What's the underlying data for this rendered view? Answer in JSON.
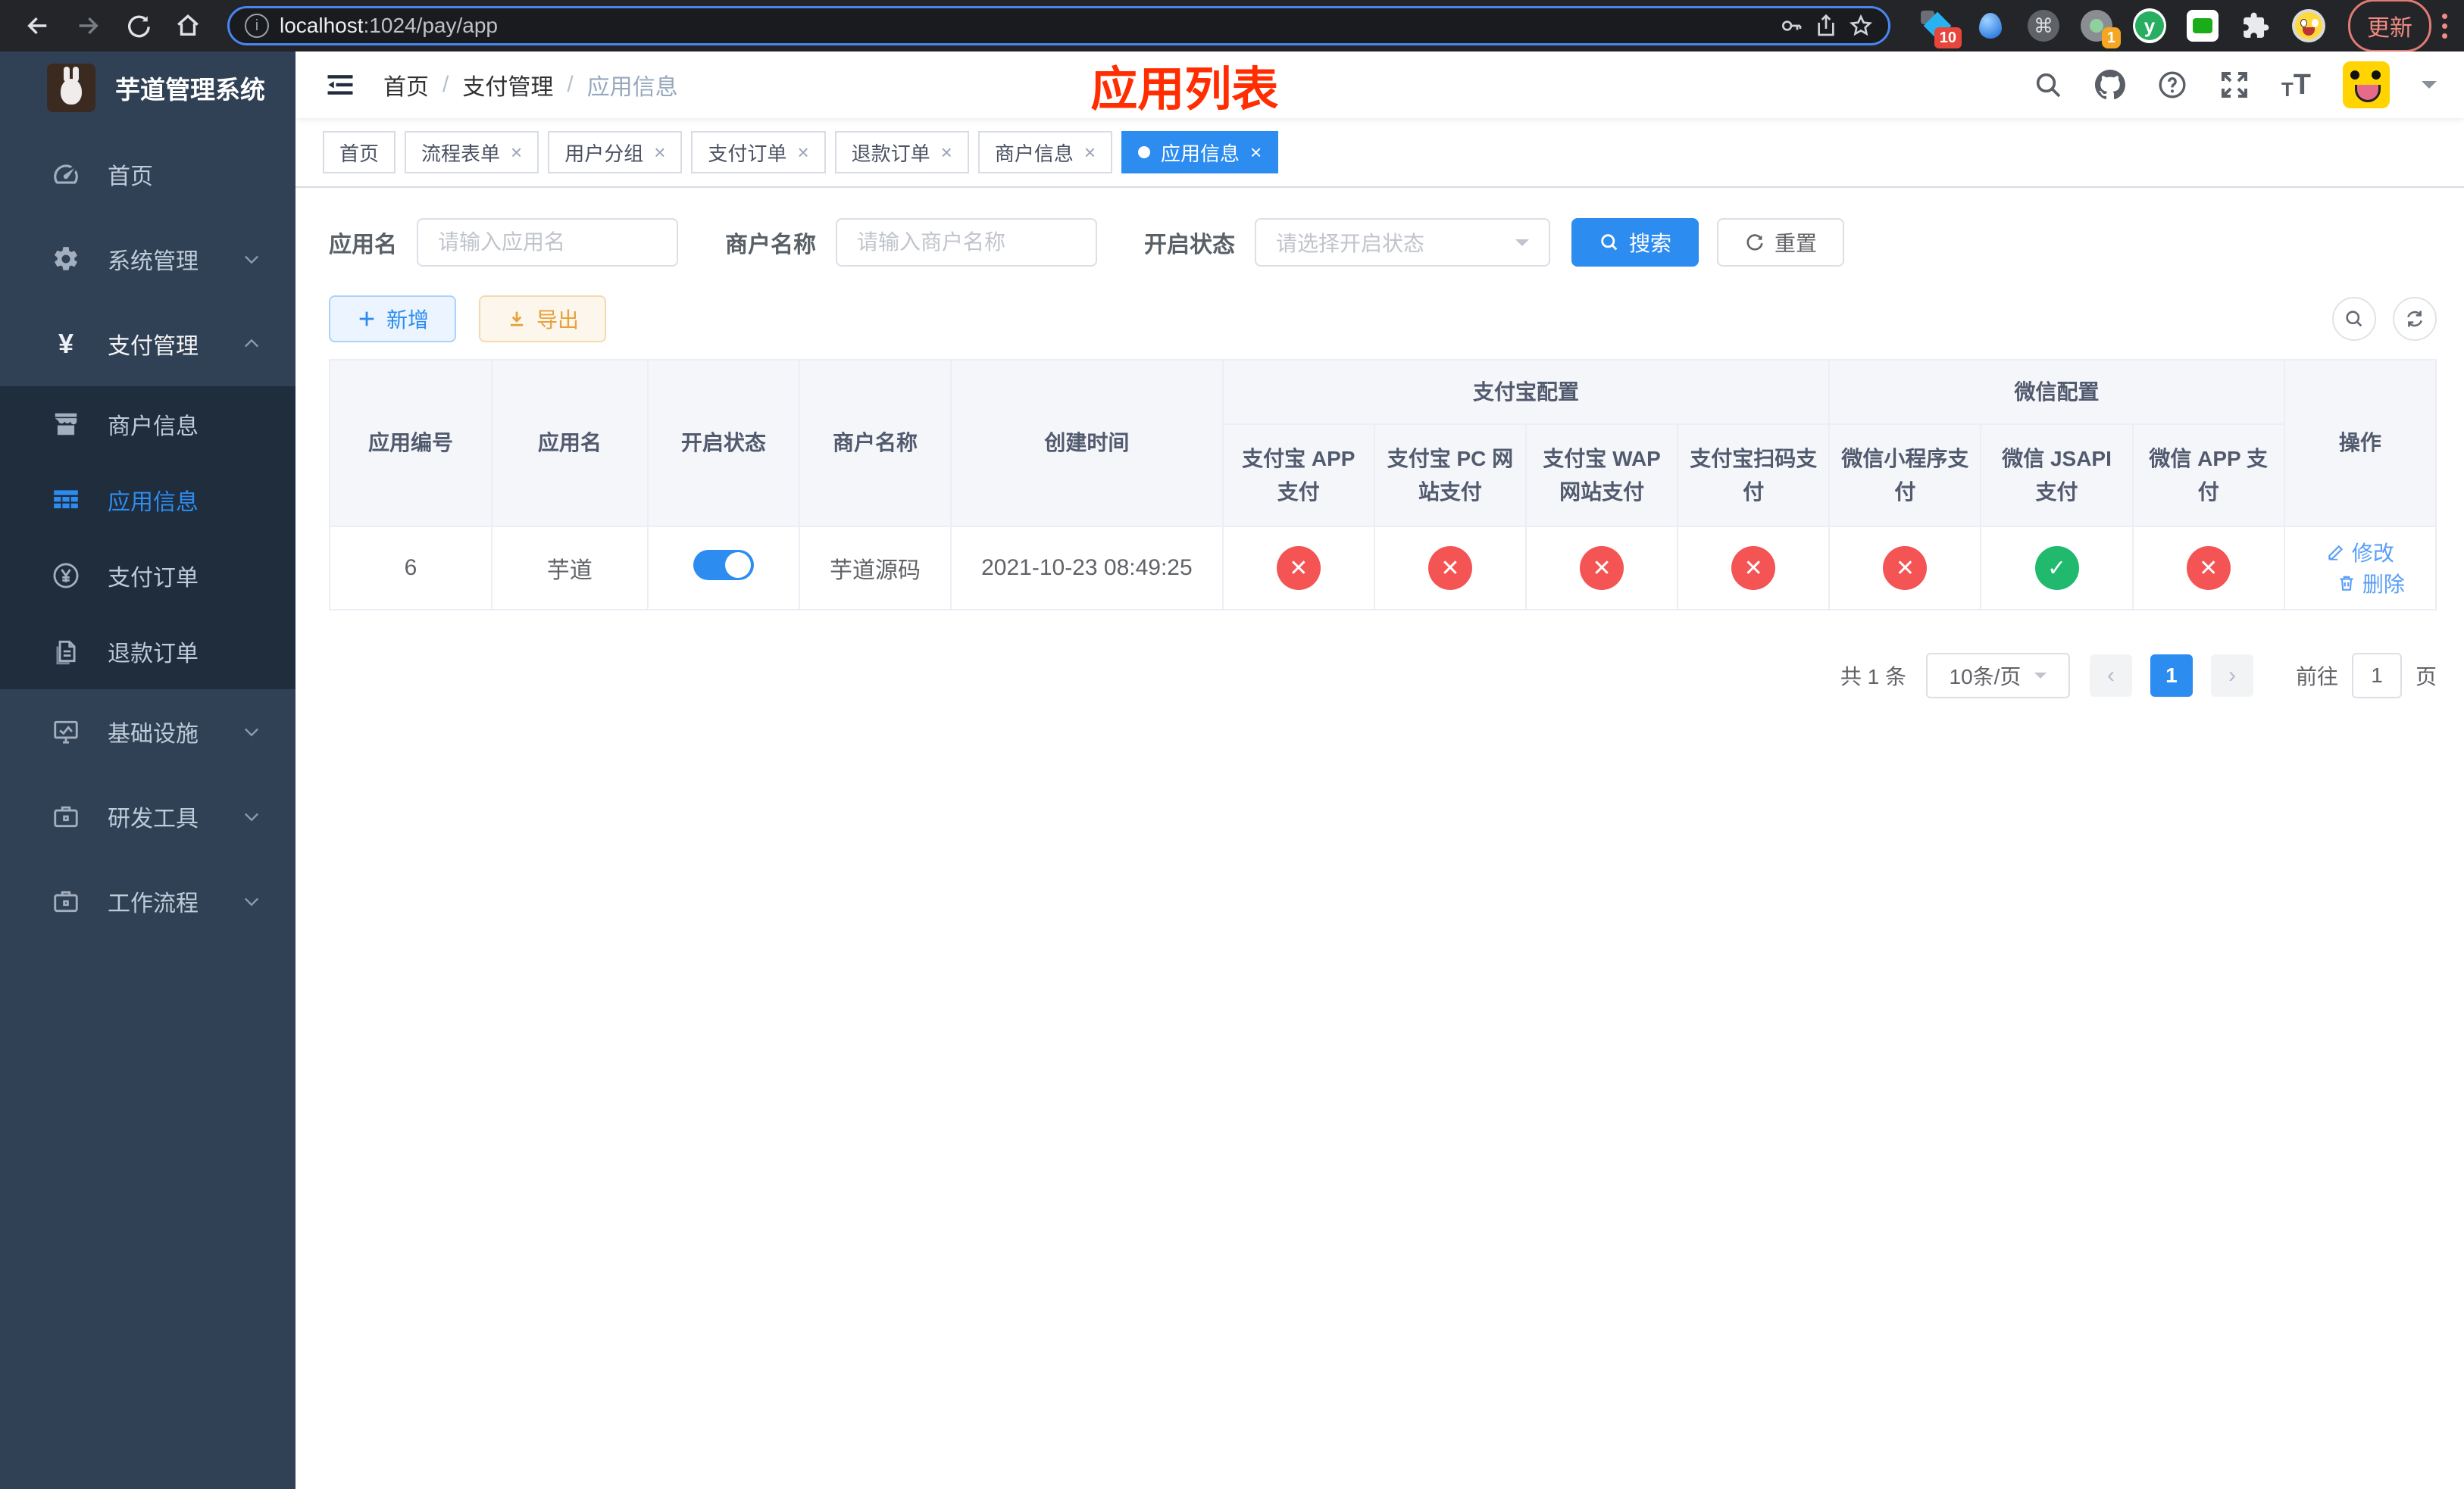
{
  "colors": {
    "primary": "#2d8cf0",
    "sidebar-bg": "#304156",
    "submenu-bg": "#1f2d3d",
    "sidebar-text": "#bfcbd9",
    "danger": "#f45454",
    "success": "#21b96d",
    "warn-text": "#e6a23c",
    "annotation": "#ff2d00",
    "link": "#579ef8"
  },
  "browser": {
    "url_host": "localhost",
    "url_rest": ":1024/pay/app",
    "ext_badge_blue": "10",
    "ext_badge_orange": "1",
    "cmd_glyph": "⌘",
    "y_glyph": "y",
    "update_label": "更新"
  },
  "sidebar": {
    "title": "芋道管理系统",
    "items": [
      {
        "label": "首页"
      },
      {
        "label": "系统管理"
      },
      {
        "label": "支付管理"
      },
      {
        "label": "商户信息"
      },
      {
        "label": "应用信息"
      },
      {
        "label": "支付订单"
      },
      {
        "label": "退款订单"
      },
      {
        "label": "基础设施"
      },
      {
        "label": "研发工具"
      },
      {
        "label": "工作流程"
      }
    ]
  },
  "header": {
    "breadcrumb": [
      "首页",
      "支付管理",
      "应用信息"
    ],
    "annotation": "应用列表"
  },
  "tabs": [
    {
      "label": "首页"
    },
    {
      "label": "流程表单"
    },
    {
      "label": "用户分组"
    },
    {
      "label": "支付订单"
    },
    {
      "label": "退款订单"
    },
    {
      "label": "商户信息"
    },
    {
      "label": "应用信息"
    }
  ],
  "filters": {
    "app_name_label": "应用名",
    "app_name_placeholder": "请输入应用名",
    "merchant_label": "商户名称",
    "merchant_placeholder": "请输入商户名称",
    "status_label": "开启状态",
    "status_placeholder": "请选择开启状态",
    "search_label": "搜索",
    "reset_label": "重置"
  },
  "toolbar": {
    "add_label": "新增",
    "export_label": "导出"
  },
  "table": {
    "simple_headers": [
      "应用编号",
      "应用名",
      "开启状态",
      "商户名称",
      "创建时间"
    ],
    "group_headers": [
      "支付宝配置",
      "微信配置"
    ],
    "sub_headers": [
      "支付宝 APP 支付",
      "支付宝 PC 网站支付",
      "支付宝 WAP 网站支付",
      "支付宝扫码支付",
      "微信小程序支付",
      "微信 JSAPI 支付",
      "微信 APP 支付"
    ],
    "ops_header": "操作",
    "row": {
      "id": "6",
      "name": "芋道",
      "enabled": true,
      "merchant": "芋道源码",
      "created": "2021-10-23 08:49:25",
      "statuses": [
        "no",
        "no",
        "no",
        "no",
        "no",
        "yes",
        "no"
      ],
      "edit_label": "修改",
      "delete_label": "删除"
    }
  },
  "pagination": {
    "total": "共 1 条",
    "page_size": "10条/页",
    "page": "1",
    "goto_prefix": "前往",
    "goto_value": "1",
    "goto_suffix": "页"
  }
}
